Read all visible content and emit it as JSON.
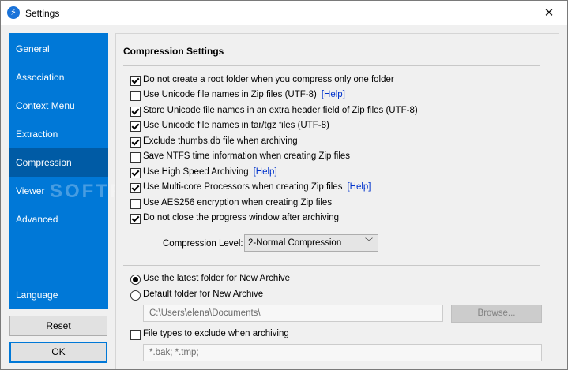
{
  "window": {
    "title": "Settings"
  },
  "sidebar": {
    "items": [
      {
        "label": "General",
        "active": false
      },
      {
        "label": "Association",
        "active": false
      },
      {
        "label": "Context Menu",
        "active": false
      },
      {
        "label": "Extraction",
        "active": false
      },
      {
        "label": "Compression",
        "active": true
      },
      {
        "label": "Viewer",
        "active": false
      },
      {
        "label": "Advanced",
        "active": false
      }
    ],
    "language": "Language"
  },
  "buttons": {
    "reset": "Reset",
    "ok": "OK"
  },
  "watermark": "SOFTPE",
  "compression": {
    "title": "Compression Settings",
    "options": [
      {
        "label": "Do not create a root folder when you compress only one folder",
        "checked": true
      },
      {
        "label": "Use Unicode file names in Zip files (UTF-8)",
        "checked": false,
        "help": "[Help]"
      },
      {
        "label": "Store Unicode file names in an extra header field of Zip files (UTF-8)",
        "checked": true
      },
      {
        "label": "Use Unicode file names in tar/tgz files (UTF-8)",
        "checked": true
      },
      {
        "label": "Exclude thumbs.db file when archiving",
        "checked": true
      },
      {
        "label": "Save NTFS time information when creating Zip files",
        "checked": false
      },
      {
        "label": "Use High Speed Archiving",
        "checked": true,
        "help": "[Help]"
      },
      {
        "label": "Use Multi-core Processors when creating Zip files",
        "checked": true,
        "help": "[Help]"
      },
      {
        "label": "Use AES256 encryption when creating Zip files",
        "checked": false
      },
      {
        "label": "Do not close the progress window after archiving",
        "checked": true
      }
    ],
    "level_label": "Compression Level:",
    "level_value": "2-Normal Compression",
    "radio_latest": "Use the latest folder for New Archive",
    "radio_default": "Default folder for New Archive",
    "radio_selected": "latest",
    "default_folder_path": "C:\\Users\\elena\\Documents\\",
    "browse_label": "Browse...",
    "exclude_label": "File types to exclude when archiving",
    "exclude_checked": false,
    "exclude_value": "*.bak; *.tmp;"
  }
}
